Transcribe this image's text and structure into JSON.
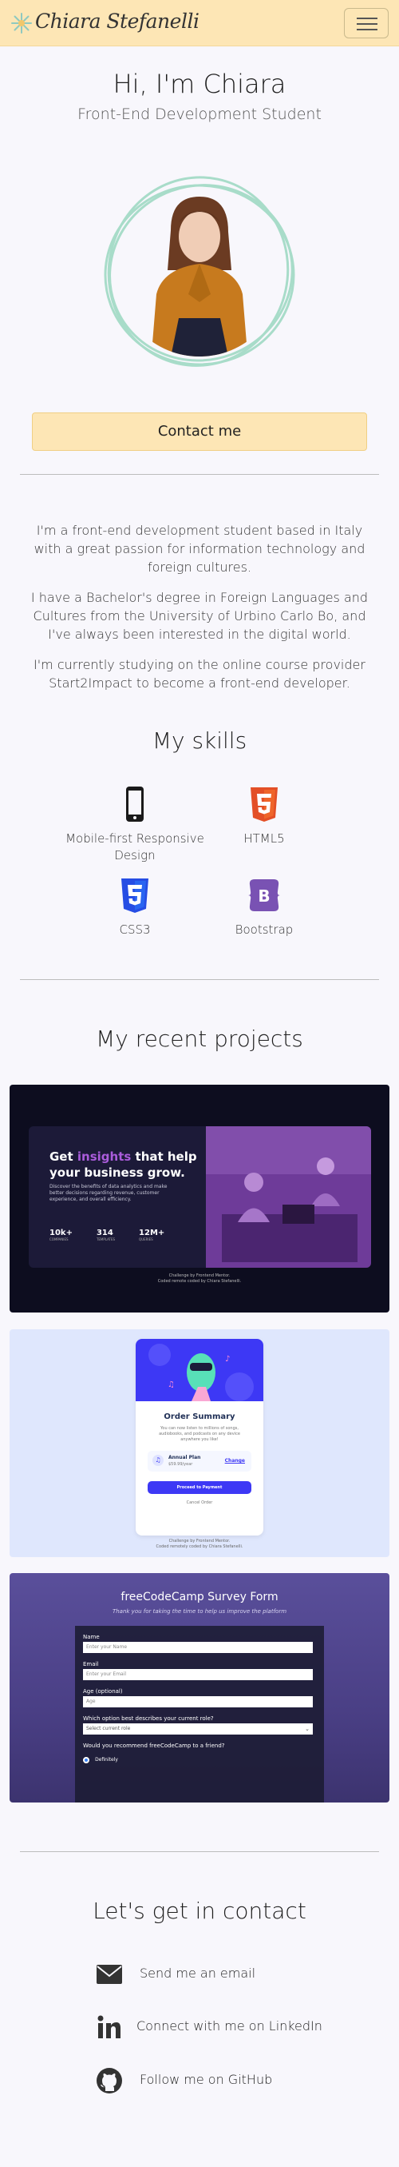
{
  "nav": {
    "brand": "Chiara Stefanelli",
    "menu_icon": "hamburger-icon"
  },
  "hero": {
    "title": "Hi, I'm Chiara",
    "subtitle": "Front-End Development Student",
    "contact_label": "Contact me"
  },
  "about": {
    "p1": "I'm a front-end development student based in Italy with a great passion for information technology and foreign cultures.",
    "p2": "I have a Bachelor's degree in Foreign Languages and Cultures from the University of Urbino Carlo Bo, and I've always been interested in the digital world.",
    "p3": "I'm currently studying on the online course provider Start2Impact to become a front-end developer."
  },
  "skills": {
    "title": "My skills",
    "items": [
      {
        "label": "Mobile-first Responsive Design",
        "icon": "mobile-icon"
      },
      {
        "label": "HTML5",
        "icon": "html5-icon"
      },
      {
        "label": "CSS3",
        "icon": "css3-icon"
      },
      {
        "label": "Bootstrap",
        "icon": "bootstrap-icon"
      }
    ]
  },
  "projects": {
    "title": "My recent projects",
    "p1": {
      "heading_a": "Get ",
      "heading_hl": "insights",
      "heading_b": " that help",
      "heading_c": "your business grow.",
      "desc": "Discover the benefits of data analytics and make better decisions regarding revenue, customer experience, and overall efficiency.",
      "stats": [
        {
          "num": "10k+",
          "lbl": "COMPANIES"
        },
        {
          "num": "314",
          "lbl": "TEMPLATES"
        },
        {
          "num": "12M+",
          "lbl": "QUERIES"
        }
      ],
      "credit1": "Challenge by Frontend Mentor.",
      "credit2": "Coded remote coded by Chiara Stefanelli."
    },
    "p2": {
      "title": "Order Summary",
      "desc": "You can now listen to millions of songs, audiobooks, and podcasts on any device anywhere you like!",
      "plan": "Annual Plan",
      "price": "$59.99/year",
      "change": "Change",
      "pay": "Proceed to Payment",
      "cancel": "Cancel Order",
      "credit1": "Challenge by Frontend Mentor.",
      "credit2": "Coded remotely coded by Chiara Stefanelli."
    },
    "p3": {
      "title": "freeCodeCamp Survey Form",
      "subtitle": "Thank you for taking the time to help us improve the platform",
      "name_label": "Name",
      "name_ph": "Enter your Name",
      "email_label": "Email",
      "email_ph": "Enter your Email",
      "age_label": "Age (optional)",
      "age_ph": "Age",
      "role_label": "Which option best describes your current role?",
      "role_ph": "Select current role",
      "rec_label": "Would you recommend freeCodeCamp to a friend?",
      "rec_opt": "Definitely"
    }
  },
  "contact": {
    "title": "Let's get in contact",
    "email": "Send me an email",
    "linkedin": "Connect with me on LinkedIn",
    "github": "Follow me on GitHub"
  },
  "colors": {
    "nav_bg": "#fde6b5",
    "page_bg": "#f8f7fc",
    "accent_purple": "#8e44ad",
    "html5": "#e34f26",
    "css3": "#264de4",
    "bootstrap": "#7952b3"
  }
}
